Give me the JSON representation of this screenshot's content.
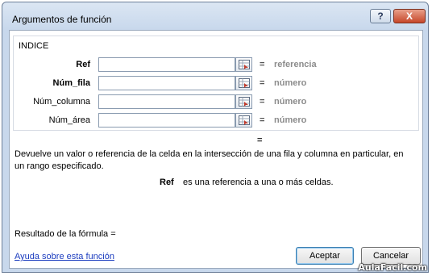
{
  "window": {
    "title": "Argumentos de función",
    "help_button": "?",
    "close_button": "X"
  },
  "function_name": "INDICE",
  "arguments": [
    {
      "label": "Ref",
      "bold": true,
      "value": "",
      "result": "referencia"
    },
    {
      "label": "Núm_fila",
      "bold": true,
      "value": "",
      "result": "número"
    },
    {
      "label": "Núm_columna",
      "bold": false,
      "value": "",
      "result": "número"
    },
    {
      "label": "Núm_área",
      "bold": false,
      "value": "",
      "result": "número"
    }
  ],
  "equals_sign": "=",
  "function_result": "=",
  "description": "Devuelve un valor o referencia de la celda en la intersección de una fila y columna en particular, en un rango especificado.",
  "argument_help": {
    "name": "Ref",
    "text": "es una referencia a una o más celdas."
  },
  "formula_result_label": "Resultado de la fórmula =",
  "help_link": "Ayuda sobre esta función",
  "buttons": {
    "ok": "Aceptar",
    "cancel": "Cancelar"
  },
  "watermark": "AulaFacil.com"
}
